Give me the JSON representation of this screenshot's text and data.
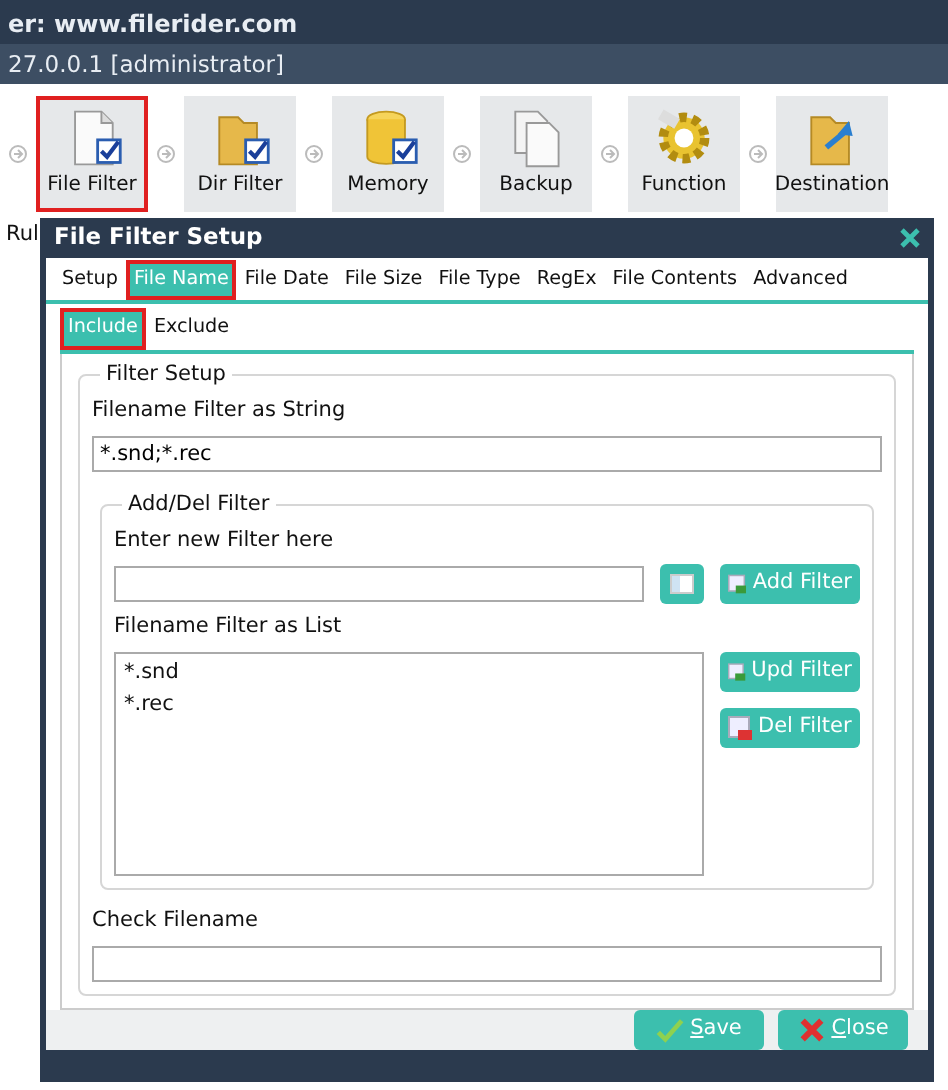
{
  "app": {
    "title": "er: www.filerider.com",
    "connection": "27.0.0.1 [administrator]",
    "toolbar": [
      {
        "label": "File Filter",
        "kind": "file-check",
        "highlighted": true
      },
      {
        "label": "Dir Filter",
        "kind": "folder-check",
        "highlighted": false
      },
      {
        "label": "Memory",
        "kind": "db-check",
        "highlighted": false
      },
      {
        "label": "Backup",
        "kind": "docs",
        "highlighted": false
      },
      {
        "label": "Function",
        "kind": "gear",
        "highlighted": false
      },
      {
        "label": "Destination",
        "kind": "folder-arrow",
        "highlighted": false
      }
    ],
    "behind_label": "Rul"
  },
  "dialog": {
    "title": "File Filter Setup",
    "tabs": [
      {
        "label": "Setup",
        "selected": false,
        "highlighted": false
      },
      {
        "label": "File Name",
        "selected": true,
        "highlighted": true
      },
      {
        "label": "File Date",
        "selected": false,
        "highlighted": false
      },
      {
        "label": "File Size",
        "selected": false,
        "highlighted": false
      },
      {
        "label": "File Type",
        "selected": false,
        "highlighted": false
      },
      {
        "label": "RegEx",
        "selected": false,
        "highlighted": false
      },
      {
        "label": "File Contents",
        "selected": false,
        "highlighted": false
      },
      {
        "label": "Advanced",
        "selected": false,
        "highlighted": false
      }
    ],
    "subtabs": [
      {
        "label": "Include",
        "selected": true,
        "highlighted": true
      },
      {
        "label": "Exclude",
        "selected": false,
        "highlighted": false
      }
    ],
    "group_title": "Filter Setup",
    "string_label": "Filename Filter as String",
    "string_value": "*.snd;*.rec",
    "adddel_title": "Add/Del Filter",
    "new_label": "Enter new Filter here",
    "list_label": "Filename Filter as List",
    "list_items": [
      "*.snd",
      "*.rec"
    ],
    "side_buttons": [
      {
        "label": "Add Filter",
        "kind": "add"
      },
      {
        "label": "Upd Filter",
        "kind": "upd"
      },
      {
        "label": "Del Filter",
        "kind": "del"
      }
    ],
    "check_label": "Check Filename",
    "footer_buttons": [
      {
        "label": "Save",
        "kind": "save"
      },
      {
        "label": "Close",
        "kind": "close"
      }
    ]
  }
}
